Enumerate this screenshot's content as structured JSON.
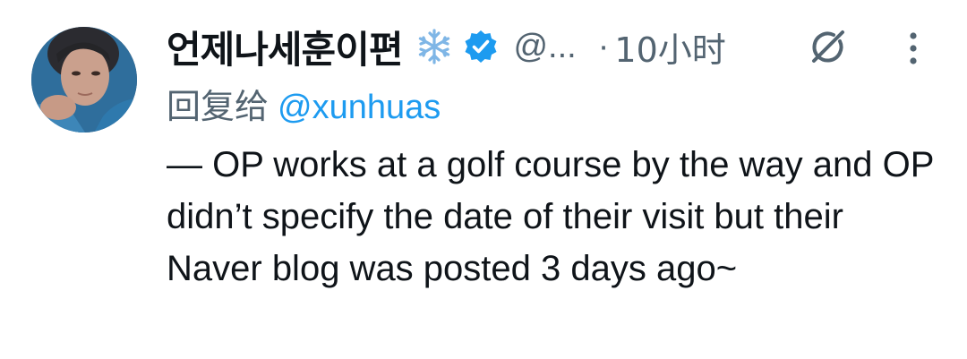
{
  "tweet": {
    "display_name": "언제나세훈이편",
    "name_emoji_icon": "snowflake-icon",
    "verified_icon": "verified-badge-icon",
    "handle": "@...",
    "separator": "·",
    "time": "10小时",
    "reply_prefix": "回复给",
    "reply_mention": "@xunhuas",
    "text": "— OP works at a golf course by the way and OP didn’t specify the date of their visit but their Naver blog was posted 3 days ago~",
    "actions": {
      "grok_icon": "grok-icon",
      "more_icon": "more-vertical-icon"
    },
    "colors": {
      "accent": "#1d9bf0",
      "secondary_text": "#536471",
      "primary_text": "#0f1419",
      "emoji": "#7fb6e6"
    }
  }
}
